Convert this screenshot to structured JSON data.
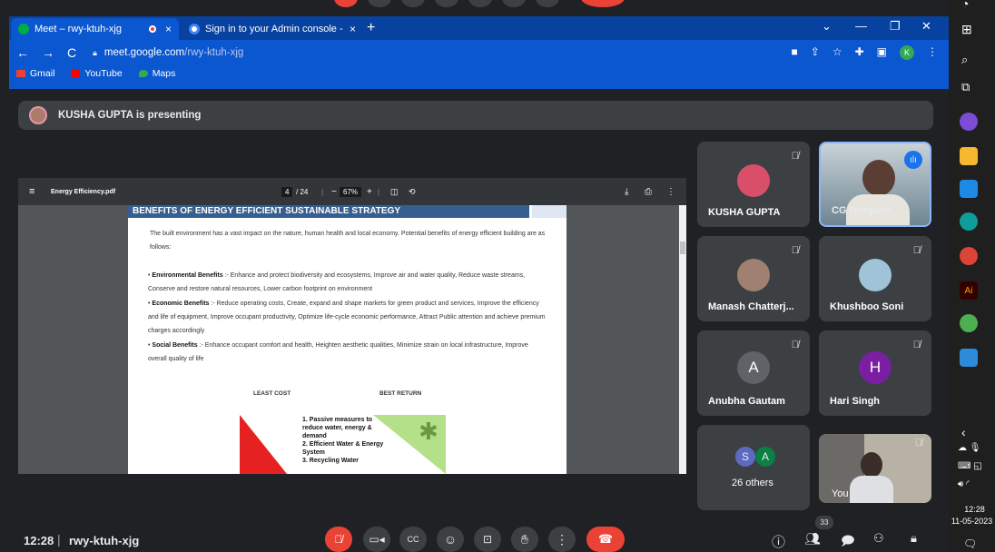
{
  "browser": {
    "tabs": [
      {
        "label": "Meet – rwy-ktuh-xjg",
        "close": "×"
      },
      {
        "label": "Sign in to your Admin console - ",
        "close": "×"
      }
    ],
    "new_tab": "+",
    "url_domain": "meet.google.com",
    "url_path": "/rwy-ktuh-xjg",
    "profile_initial": "K",
    "bookmarks": [
      "Gmail",
      "YouTube",
      "Maps"
    ]
  },
  "presenting": {
    "text": "KUSHA GUPTA is presenting"
  },
  "pdf": {
    "filename": "Energy Efficiency.pdf",
    "page": "4",
    "page_total": "/ 24",
    "zoom": "67%",
    "heading": "BENEFITS OF ENERGY EFFICIENT SUSTAINABLE STRATEGY",
    "intro": "The built environment has a vast impact on the nature, human health and local economy. Potential benefits of energy efficient building are as follows:",
    "bullets": [
      {
        "title": "Environmental Benefits",
        "text": " :- Enhance and protect biodiversity and ecosystems, Improve air and water quality, Reduce waste streams, Conserve and restore natural resources, Lower carbon footprint on environment"
      },
      {
        "title": "Economic Benefits",
        "text": " :- Reduce operating costs, Create, expand and shape markets for green product and services, Improve the efficiency and life of equipment, Improve occupant productivity, Optimize life-cycle economic performance, Attract Public attention and achieve premium charges accordingly"
      },
      {
        "title": "Social Benefits",
        "text": " :- Enhance occupant comfort and health, Heighten aesthetic qualities, Minimize strain on local infrastructure, Improve overall quality of life"
      }
    ],
    "diagram_left": "LEAST COST",
    "diagram_right": "BEST RETURN",
    "list": [
      "1. Passive measures to reduce water, energy & demand",
      "2. Efficient Water & Energy System",
      "3. Recycling Water"
    ]
  },
  "participants": [
    {
      "name": "KUSHA GUPTA"
    },
    {
      "name": "CG Gurgaon"
    },
    {
      "name": "Manash Chatterj..."
    },
    {
      "name": "Khushboo Soni"
    },
    {
      "name": "Anubha Gautam",
      "initial": "A",
      "color": "#5f6368"
    },
    {
      "name": "Hari Singh",
      "initial": "H",
      "color": "#7b1fa2"
    },
    {
      "name": "26 others",
      "initials": [
        "S",
        "A"
      ]
    },
    {
      "name": "You"
    }
  ],
  "meeting": {
    "time": "12:28",
    "code": "rwy-ktuh-xjg",
    "people_count": "33"
  },
  "taskbar": {
    "clock": "12:28",
    "date": "11-05-2023"
  },
  "colors": {
    "end_call": "#ea4335",
    "mute_on": "#ea4335",
    "accent": "#8ab4f8"
  }
}
